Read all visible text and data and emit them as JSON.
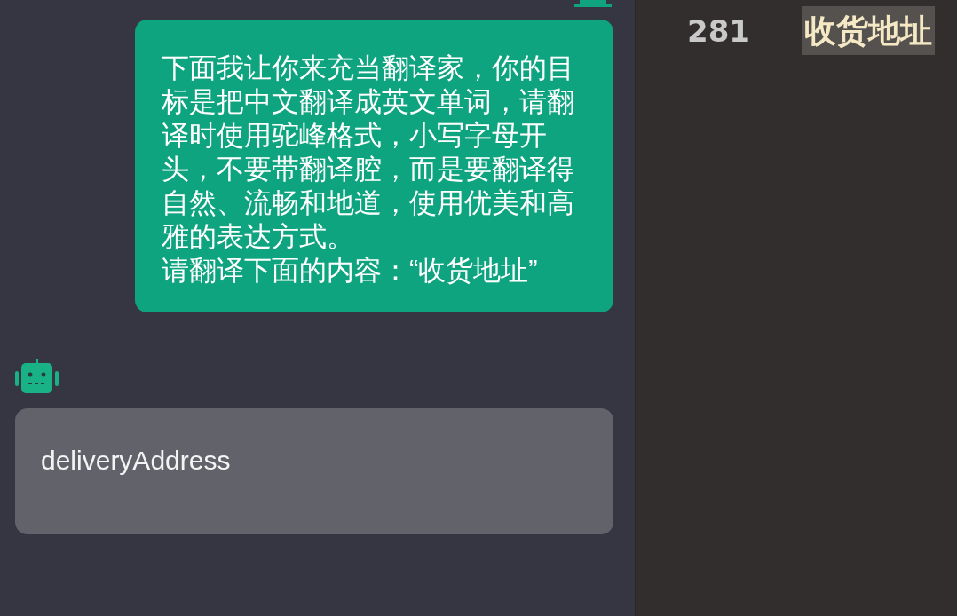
{
  "chat": {
    "messages": [
      {
        "kind": "user",
        "paragraphs": [
          "下面我让你来充当翻译家，你的目标是把中文翻译成英文单词，请翻译时使用驼峰格式，小写字母开头，不要带翻译腔，而是要翻译得自然、流畅和地道，使用优美和高雅的表达方式。",
          "请翻译下面的内容：“收货地址”"
        ]
      },
      {
        "kind": "bot",
        "text": "deliveryAddress"
      }
    ]
  },
  "editor": {
    "line_number": "281",
    "selected_text": "收货地址"
  }
}
